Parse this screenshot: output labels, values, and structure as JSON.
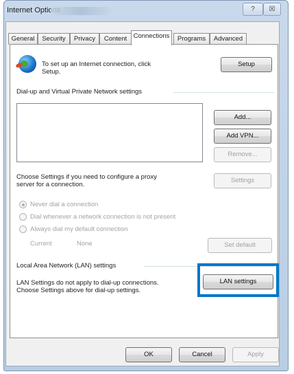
{
  "window": {
    "title": "Internet Options",
    "help_label": "?",
    "close_label": "☒"
  },
  "tabs": [
    "General",
    "Security",
    "Privacy",
    "Content",
    "Connections",
    "Programs",
    "Advanced"
  ],
  "active_tab": "Connections",
  "setup": {
    "text_line1": "To set up an Internet connection, click",
    "text_line2": "Setup.",
    "button_label": "Setup"
  },
  "dialup": {
    "group_label": "Dial-up and Virtual Private Network settings",
    "add_label": "Add...",
    "add_vpn_label": "Add VPN...",
    "remove_label": "Remove...",
    "settings_text_line1": "Choose Settings if you need to configure a proxy",
    "settings_text_line2": "server for a connection.",
    "settings_label": "Settings",
    "radio_never": "Never dial a connection",
    "radio_whenever": "Dial whenever a network connection is not present",
    "radio_always": "Always dial my default connection",
    "current_label": "Current",
    "current_value": "None",
    "set_default_label": "Set default"
  },
  "lan": {
    "group_label": "Local Area Network (LAN) settings",
    "text_line1": "LAN Settings do not apply to dial-up connections.",
    "text_line2": "Choose Settings above for dial-up settings.",
    "button_label": "LAN settings"
  },
  "footer": {
    "ok_label": "OK",
    "cancel_label": "Cancel",
    "apply_label": "Apply"
  },
  "colors": {
    "highlight": "#0077c8"
  }
}
